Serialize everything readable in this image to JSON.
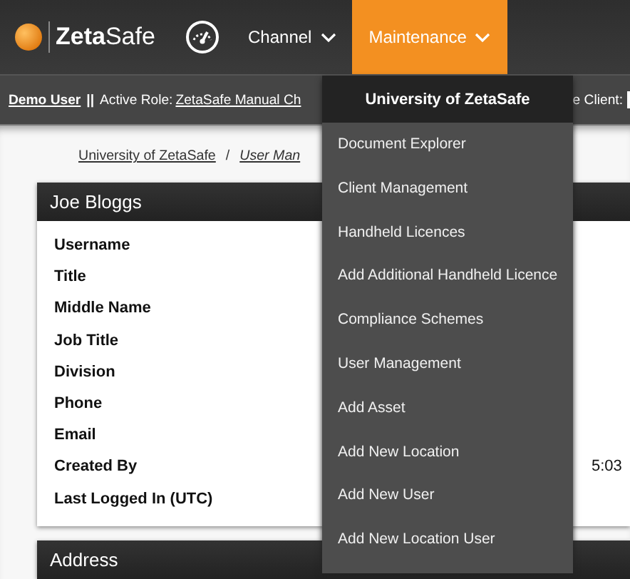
{
  "navbar": {
    "logo": {
      "bold": "Zeta",
      "rest": "Safe"
    },
    "items": [
      {
        "kind": "icon"
      },
      {
        "kind": "menu",
        "label": "Channel",
        "selected": false
      },
      {
        "kind": "menu",
        "label": "Maintenance",
        "selected": true
      }
    ]
  },
  "user_bar": {
    "user": "Demo User",
    "separator": "||",
    "role_label": "Active Role:",
    "role": "ZetaSafe Manual Ch",
    "client_label": "e Client:"
  },
  "breadcrumb": [
    {
      "label": "University of ZetaSafe",
      "italic": false
    },
    {
      "label": "User Man",
      "italic": true
    }
  ],
  "breadcrumb_separator": "/",
  "user_card": {
    "title": "Joe Bloggs",
    "fields": [
      {
        "label": "Username"
      },
      {
        "label": "Title"
      },
      {
        "label": "Middle Name"
      },
      {
        "label": "Job Title"
      },
      {
        "label": "Division"
      },
      {
        "label": "Phone"
      },
      {
        "label": "Email"
      },
      {
        "label": "Created By"
      },
      {
        "label": "Last Logged In (UTC)"
      }
    ]
  },
  "created_value": "5:03",
  "address_card": {
    "title": "Address"
  },
  "dropdown": {
    "header": "University of ZetaSafe",
    "items": [
      "Document Explorer",
      "Client Management",
      "Handheld Licences",
      "Add Additional Handheld Licence",
      "Compliance Schemes",
      "User Management",
      "Add Asset",
      "Add New Location",
      "Add New User",
      "Add New Location User"
    ]
  }
}
